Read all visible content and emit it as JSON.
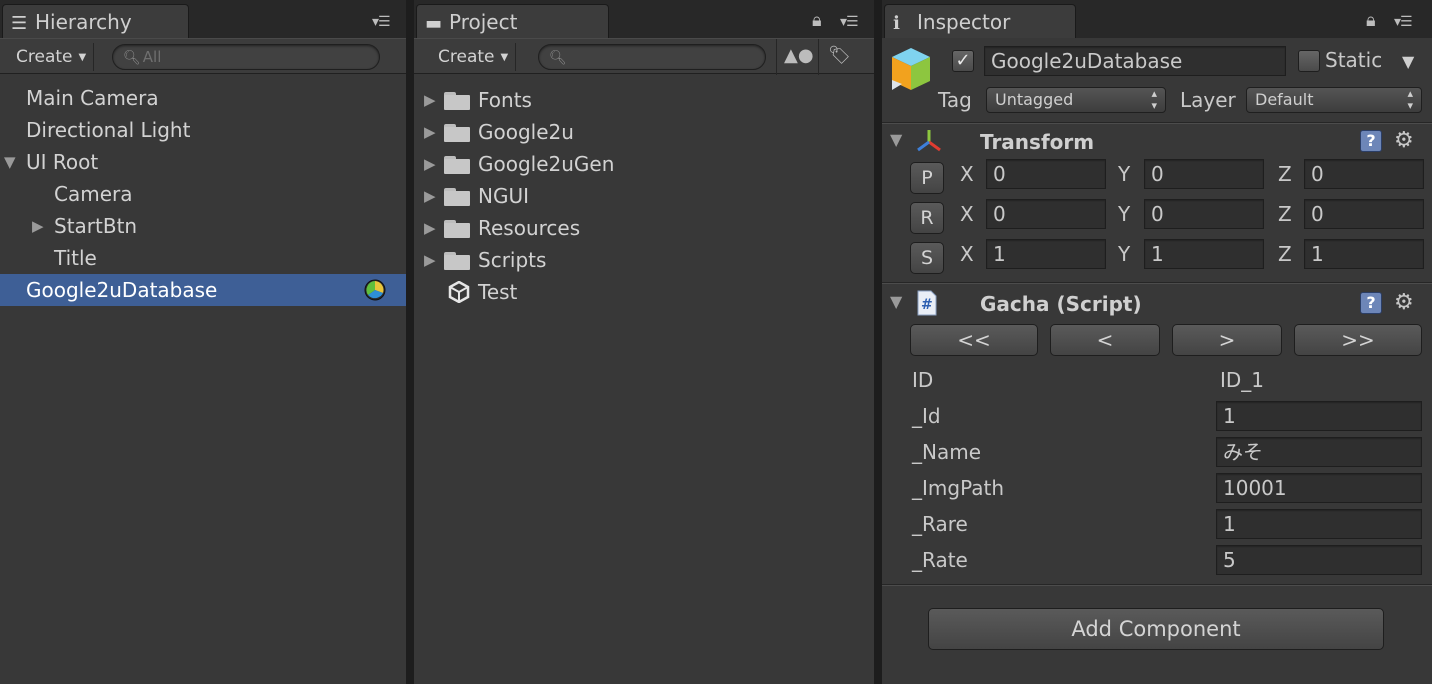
{
  "hierarchy": {
    "tab_title": "Hierarchy",
    "create_label": "Create",
    "search_placeholder": "All",
    "items": [
      {
        "label": "Main Camera"
      },
      {
        "label": "Directional Light"
      },
      {
        "label": "UI Root"
      },
      {
        "label": "Camera"
      },
      {
        "label": "StartBtn"
      },
      {
        "label": "Title"
      },
      {
        "label": "Google2uDatabase"
      }
    ],
    "selected_item": "Google2uDatabase",
    "selection_color": "#3e5f96"
  },
  "project": {
    "tab_title": "Project",
    "create_label": "Create",
    "search_placeholder": "",
    "items": [
      {
        "label": "Fonts",
        "icon": "folder-icon"
      },
      {
        "label": "Google2u",
        "icon": "folder-icon"
      },
      {
        "label": "Google2uGen",
        "icon": "folder-icon"
      },
      {
        "label": "NGUI",
        "icon": "folder-icon"
      },
      {
        "label": "Resources",
        "icon": "folder-icon"
      },
      {
        "label": "Scripts",
        "icon": "folder-icon"
      },
      {
        "label": "Test",
        "icon": "unity-scene-icon"
      }
    ]
  },
  "inspector": {
    "tab_title": "Inspector",
    "object_name": "Google2uDatabase",
    "active_checked": true,
    "static_label": "Static",
    "tag_label": "Tag",
    "tag_value": "Untagged",
    "layer_label": "Layer",
    "layer_value": "Default",
    "transform": {
      "title": "Transform",
      "rows": [
        {
          "button": "P",
          "x": "0",
          "y": "0",
          "z": "0"
        },
        {
          "button": "R",
          "x": "0",
          "y": "0",
          "z": "0"
        },
        {
          "button": "S",
          "x": "1",
          "y": "1",
          "z": "1"
        }
      ],
      "axis_x": "X",
      "axis_y": "Y",
      "axis_z": "Z"
    },
    "script": {
      "title": "Gacha (Script)",
      "nav_buttons": [
        "<<",
        "<",
        ">",
        ">>"
      ],
      "id_label": "ID",
      "id_value": "ID_1",
      "fields": [
        {
          "label": "_Id",
          "value": "1"
        },
        {
          "label": "_Name",
          "value": "みそ"
        },
        {
          "label": "_ImgPath",
          "value": "10001"
        },
        {
          "label": "_Rare",
          "value": "1"
        },
        {
          "label": "_Rate",
          "value": "5"
        }
      ]
    },
    "add_component_label": "Add Component"
  }
}
